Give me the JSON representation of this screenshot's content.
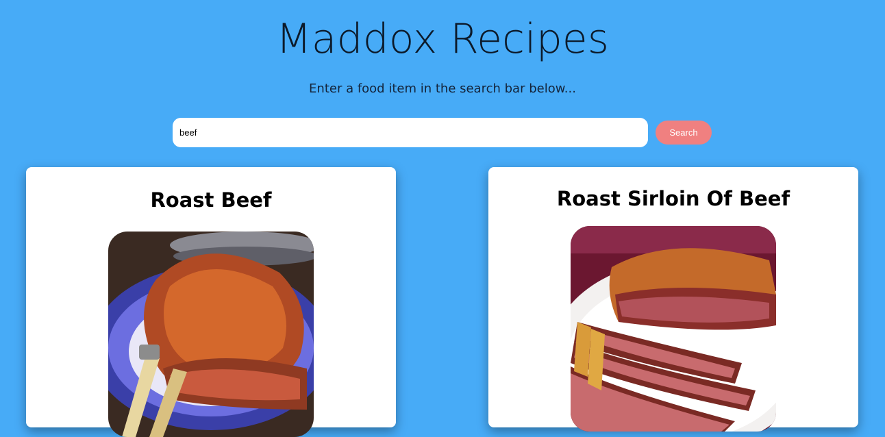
{
  "header": {
    "title": "Maddox Recipes",
    "subtitle": "Enter a food item in the search bar below..."
  },
  "search": {
    "value": "beef",
    "button_label": "Search"
  },
  "colors": {
    "background": "#47abf7",
    "button": "#f08080",
    "card": "#ffffff"
  },
  "results": [
    {
      "title": "Roast Beef",
      "image": "roast-beef-photo"
    },
    {
      "title": "Roast Sirloin Of Beef",
      "image": "roast-sirloin-photo"
    }
  ]
}
